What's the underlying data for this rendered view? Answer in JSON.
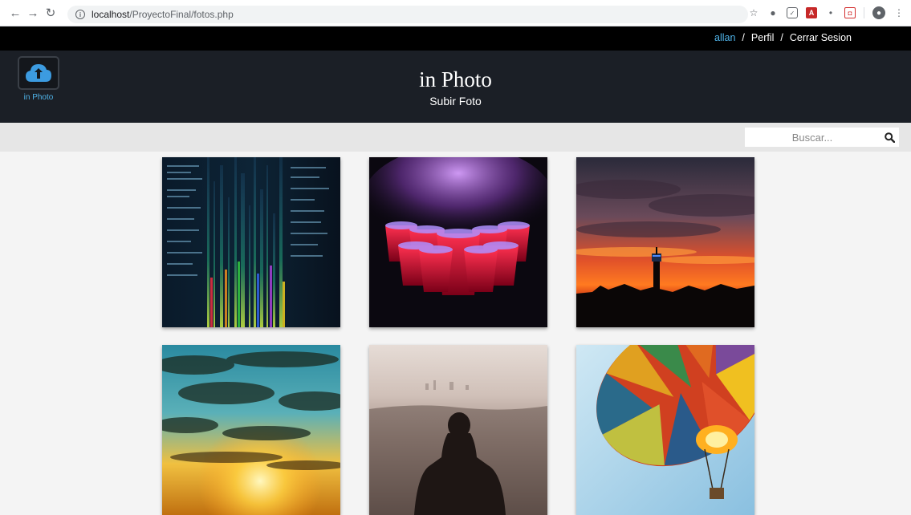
{
  "browser": {
    "url_host": "localhost",
    "url_path": "/ProyectoFinal/fotos.php"
  },
  "userbar": {
    "username": "allan",
    "separator": "/",
    "profile_label": "Perfil",
    "logout_label": "Cerrar Sesion"
  },
  "header": {
    "logo_text": "in Photo",
    "title": "in Photo",
    "subtitle": "Subir Foto"
  },
  "search": {
    "placeholder": "Buscar..."
  },
  "colors": {
    "accent": "#4fb3e8",
    "header_bg": "#1b1f26",
    "userbar_bg": "#000000"
  },
  "photos": [
    {
      "icon": "code-matrix-image"
    },
    {
      "icon": "red-cups-smoke-image"
    },
    {
      "icon": "sunset-tower-image"
    },
    {
      "icon": "sun-clouds-image"
    },
    {
      "icon": "person-city-image"
    },
    {
      "icon": "hot-air-balloon-image"
    }
  ]
}
